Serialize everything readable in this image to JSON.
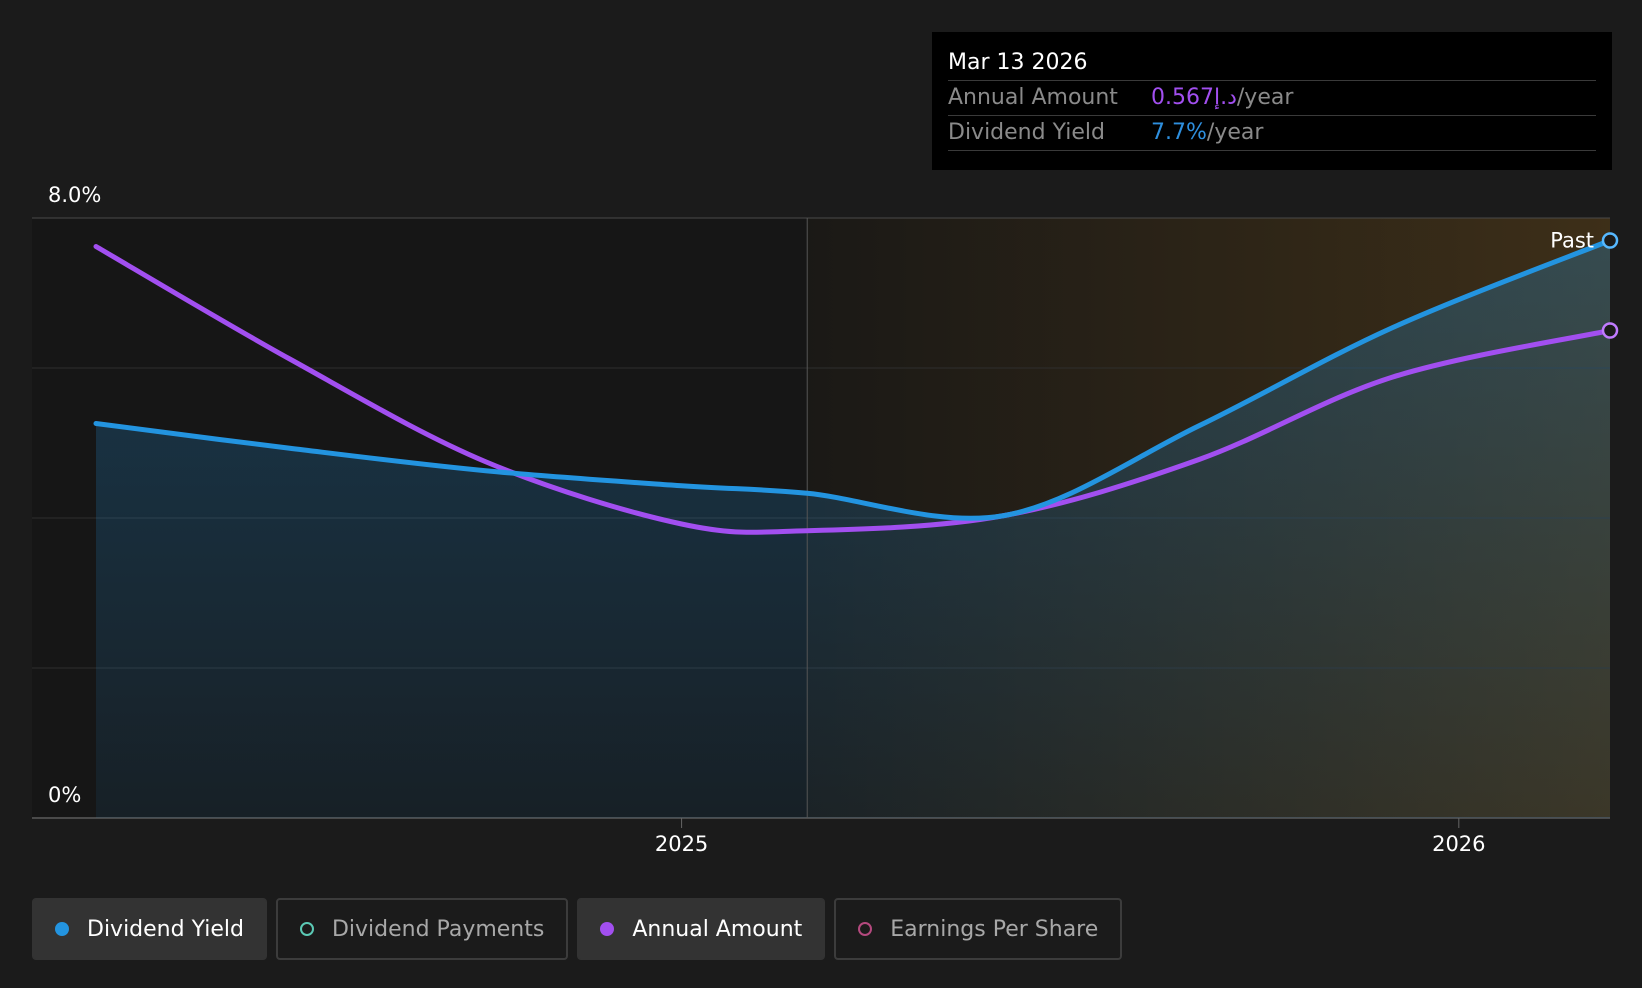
{
  "tooltip": {
    "date": "Mar 13 2026",
    "rows": [
      {
        "label": "Annual Amount",
        "value": "0.567د.إ",
        "suffix": "/year",
        "color": "#a24ff0"
      },
      {
        "label": "Dividend Yield",
        "value": "7.7%",
        "suffix": "/year",
        "color": "#2e8fde"
      }
    ]
  },
  "legend": [
    {
      "label": "Dividend Yield",
      "color": "#2394e0",
      "active": true
    },
    {
      "label": "Dividend Payments",
      "color": "#5bc9b5",
      "active": false
    },
    {
      "label": "Annual Amount",
      "color": "#a24ff0",
      "active": true
    },
    {
      "label": "Earnings Per Share",
      "color": "#b4497e",
      "active": false
    }
  ],
  "colors": {
    "background": "#1b1b1b",
    "dividend_yield": "#2394e0",
    "annual_amount": "#a24ff0",
    "past_region": "#f0a020"
  },
  "chart_data": {
    "type": "line",
    "y_tick_labels": [
      "8.0%",
      "0%"
    ],
    "ylim": [
      0,
      8
    ],
    "x_ticks": [
      {
        "label": "2025",
        "date": "2025-01-01"
      },
      {
        "label": "2026",
        "date": "2026-01-01"
      }
    ],
    "xlim": [
      "2024-04-01",
      "2026-03-13"
    ],
    "grid": true,
    "past_region": {
      "label": "Past",
      "start": "2025-03-01",
      "end": "2026-03-13"
    },
    "series": [
      {
        "name": "Dividend Yield",
        "color": "#2394e0",
        "unit": "%",
        "points": [
          [
            "2024-04-01",
            5.26
          ],
          [
            "2024-07-01",
            4.93
          ],
          [
            "2024-10-01",
            4.63
          ],
          [
            "2025-01-01",
            4.43
          ],
          [
            "2025-03-01",
            4.33
          ],
          [
            "2025-06-01",
            4.03
          ],
          [
            "2025-09-01",
            5.23
          ],
          [
            "2025-12-01",
            6.54
          ],
          [
            "2026-03-13",
            7.7
          ]
        ]
      },
      {
        "name": "Annual Amount",
        "color": "#a24ff0",
        "unit": "د.إ",
        "points": [
          [
            "2024-04-01",
            7.62
          ],
          [
            "2024-07-01",
            6.12
          ],
          [
            "2024-10-01",
            4.75
          ],
          [
            "2025-01-01",
            3.92
          ],
          [
            "2025-03-01",
            3.83
          ],
          [
            "2025-06-01",
            4.03
          ],
          [
            "2025-09-01",
            4.78
          ],
          [
            "2025-12-01",
            5.88
          ],
          [
            "2026-03-13",
            6.5
          ]
        ]
      }
    ]
  }
}
